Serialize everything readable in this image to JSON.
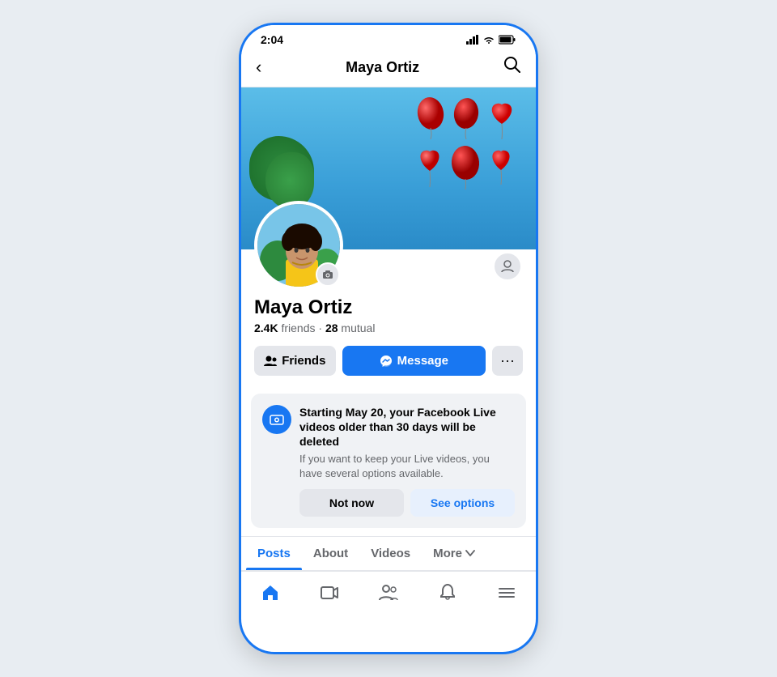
{
  "statusBar": {
    "time": "2:04",
    "signal": "▲▲▲",
    "wifi": "wifi",
    "battery": "battery"
  },
  "navbar": {
    "back": "‹",
    "title": "Maya Ortiz",
    "search": "🔍"
  },
  "profile": {
    "name": "Maya Ortiz",
    "friends_count": "2.4K",
    "friends_label": "friends",
    "mutual_count": "28",
    "mutual_label": "mutual",
    "btn_friends": "Friends",
    "btn_message": "Message",
    "btn_more_dots": "···"
  },
  "notification": {
    "title": "Starting May 20, your Facebook Live videos older than 30 days will be deleted",
    "body": "If you want to keep your Live videos, you have several options available.",
    "btn_not_now": "Not now",
    "btn_see_options": "See options"
  },
  "tabs": {
    "posts": "Posts",
    "about": "About",
    "videos": "Videos",
    "more": "More"
  },
  "bottomNav": {
    "home": "⌂",
    "video": "▶",
    "people": "👤",
    "bell": "🔔",
    "menu": "☰"
  }
}
